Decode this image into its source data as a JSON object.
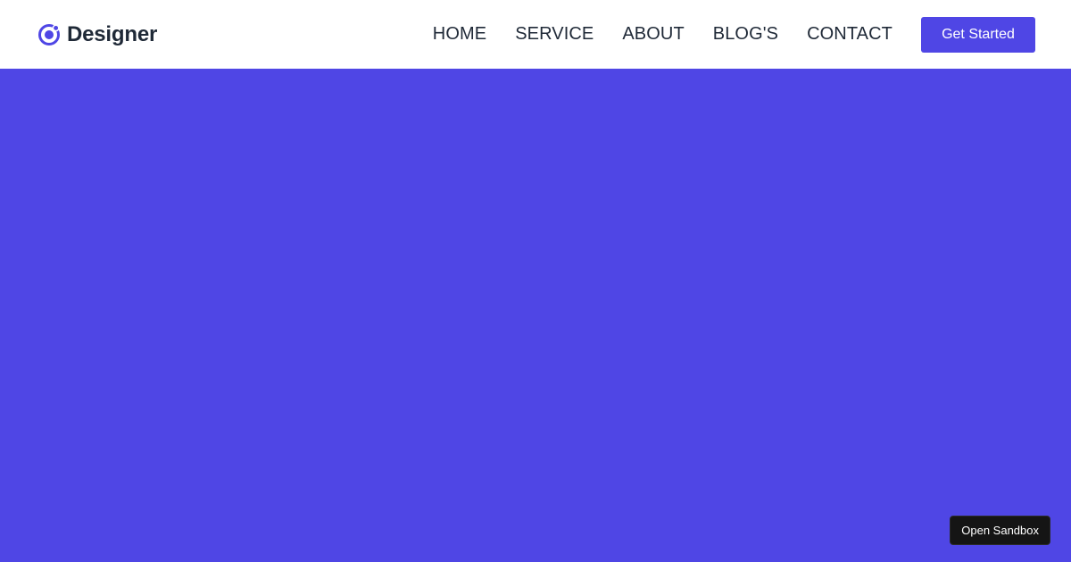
{
  "header": {
    "brand_name": "Designer",
    "brand_icon": "ionic-logo-icon",
    "nav": [
      {
        "label": "HOME"
      },
      {
        "label": "SERVICE"
      },
      {
        "label": "ABOUT"
      },
      {
        "label": "BLOG'S"
      },
      {
        "label": "CONTACT"
      }
    ],
    "cta_label": "Get Started"
  },
  "sandbox": {
    "label": "Open Sandbox"
  },
  "colors": {
    "accent": "#4f46e5",
    "text": "#1f2937",
    "sandbox_bg": "#151515"
  }
}
